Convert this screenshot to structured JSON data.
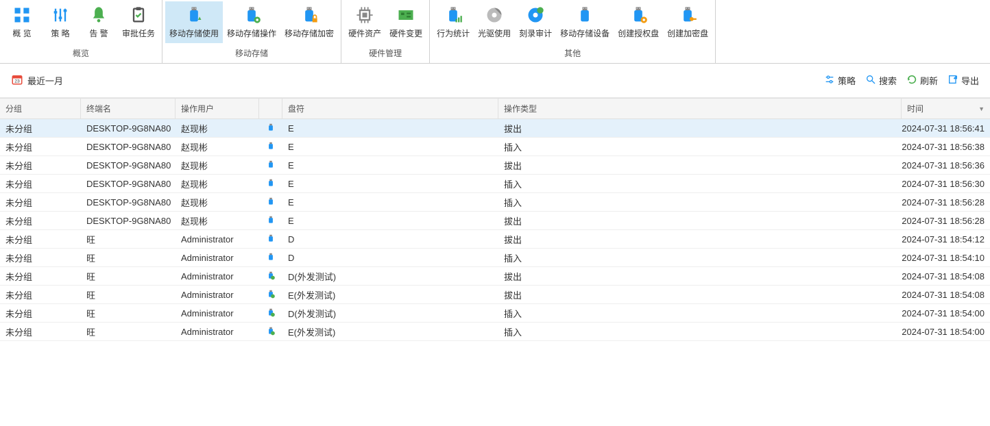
{
  "ribbon": {
    "groups": [
      {
        "label": "概览",
        "buttons": [
          {
            "name": "overview-button",
            "icon": "grid",
            "label": "概 览"
          },
          {
            "name": "policy-button",
            "icon": "sliders",
            "label": "策 略"
          },
          {
            "name": "alert-button",
            "icon": "bell",
            "label": "告 警"
          },
          {
            "name": "approval-button",
            "icon": "clipboard",
            "label": "审批任务"
          }
        ]
      },
      {
        "label": "移动存储",
        "buttons": [
          {
            "name": "usb-usage-button",
            "icon": "usb-up",
            "label": "移动存储使用",
            "active": true
          },
          {
            "name": "usb-op-button",
            "icon": "usb-gear",
            "label": "移动存储操作"
          },
          {
            "name": "usb-encrypt-button",
            "icon": "usb-lock",
            "label": "移动存储加密"
          }
        ]
      },
      {
        "label": "硬件管理",
        "buttons": [
          {
            "name": "hw-asset-button",
            "icon": "cpu",
            "label": "硬件资产"
          },
          {
            "name": "hw-change-button",
            "icon": "board",
            "label": "硬件变更"
          }
        ]
      },
      {
        "label": "其他",
        "buttons": [
          {
            "name": "behavior-button",
            "icon": "usb-stat",
            "label": "行为统计"
          },
          {
            "name": "optical-button",
            "icon": "disc",
            "label": "光驱使用"
          },
          {
            "name": "burn-button",
            "icon": "disc-burn",
            "label": "刻录审计"
          },
          {
            "name": "usb-device-button",
            "icon": "usb-plain",
            "label": "移动存储设备"
          },
          {
            "name": "create-auth-button",
            "icon": "usb-auth",
            "label": "创建授权盘"
          },
          {
            "name": "create-encrypt-button",
            "icon": "usb-key",
            "label": "创建加密盘"
          }
        ]
      }
    ]
  },
  "filter": {
    "date_label": "最近一月",
    "actions": [
      {
        "name": "filter-policy",
        "icon": "sliders-h",
        "label": "策略"
      },
      {
        "name": "filter-search",
        "icon": "search",
        "label": "搜索"
      },
      {
        "name": "filter-refresh",
        "icon": "refresh",
        "label": "刷新"
      },
      {
        "name": "filter-export",
        "icon": "export",
        "label": "导出"
      }
    ]
  },
  "table": {
    "headers": {
      "group": "分组",
      "terminal": "终端名",
      "user": "操作用户",
      "icon": "",
      "drive": "盘符",
      "op": "操作类型",
      "time": "时间"
    },
    "rows": [
      {
        "group": "未分组",
        "terminal": "DESKTOP-9G8NA80",
        "user": "赵现彬",
        "iconType": "usb",
        "drive": "E",
        "op": "拔出",
        "time": "2024-07-31 18:56:41",
        "sel": true
      },
      {
        "group": "未分组",
        "terminal": "DESKTOP-9G8NA80",
        "user": "赵现彬",
        "iconType": "usb",
        "drive": "E",
        "op": "插入",
        "time": "2024-07-31 18:56:38"
      },
      {
        "group": "未分组",
        "terminal": "DESKTOP-9G8NA80",
        "user": "赵现彬",
        "iconType": "usb",
        "drive": "E",
        "op": "拔出",
        "time": "2024-07-31 18:56:36"
      },
      {
        "group": "未分组",
        "terminal": "DESKTOP-9G8NA80",
        "user": "赵现彬",
        "iconType": "usb",
        "drive": "E",
        "op": "插入",
        "time": "2024-07-31 18:56:30"
      },
      {
        "group": "未分组",
        "terminal": "DESKTOP-9G8NA80",
        "user": "赵现彬",
        "iconType": "usb",
        "drive": "E",
        "op": "插入",
        "time": "2024-07-31 18:56:28"
      },
      {
        "group": "未分组",
        "terminal": "DESKTOP-9G8NA80",
        "user": "赵现彬",
        "iconType": "usb",
        "drive": "E",
        "op": "拔出",
        "time": "2024-07-31 18:56:28"
      },
      {
        "group": "未分组",
        "terminal": "旺",
        "user": "Administrator",
        "iconType": "usb",
        "drive": "D",
        "op": "拔出",
        "time": "2024-07-31 18:54:12"
      },
      {
        "group": "未分组",
        "terminal": "旺",
        "user": "Administrator",
        "iconType": "usb",
        "drive": "D",
        "op": "插入",
        "time": "2024-07-31 18:54:10"
      },
      {
        "group": "未分组",
        "terminal": "旺",
        "user": "Administrator",
        "iconType": "usb-green",
        "drive": "D(外发测试)",
        "op": "拔出",
        "time": "2024-07-31 18:54:08"
      },
      {
        "group": "未分组",
        "terminal": "旺",
        "user": "Administrator",
        "iconType": "usb-green",
        "drive": "E(外发测试)",
        "op": "拔出",
        "time": "2024-07-31 18:54:08"
      },
      {
        "group": "未分组",
        "terminal": "旺",
        "user": "Administrator",
        "iconType": "usb-green",
        "drive": "D(外发测试)",
        "op": "插入",
        "time": "2024-07-31 18:54:00"
      },
      {
        "group": "未分组",
        "terminal": "旺",
        "user": "Administrator",
        "iconType": "usb-green",
        "drive": "E(外发测试)",
        "op": "插入",
        "time": "2024-07-31 18:54:00"
      }
    ]
  }
}
